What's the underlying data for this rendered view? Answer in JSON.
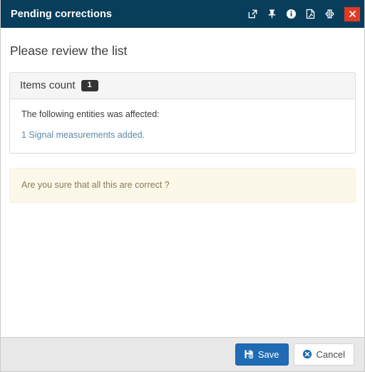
{
  "window": {
    "title": "Pending corrections",
    "titlebar_color": "#083e5c",
    "close_button_color": "#e23a22",
    "actions": [
      {
        "name": "popout-icon",
        "label": "Open in new window"
      },
      {
        "name": "pin-icon",
        "label": "Pin"
      },
      {
        "name": "info-icon",
        "label": "Information"
      },
      {
        "name": "pdf-icon",
        "label": "Export to PDF"
      },
      {
        "name": "collapse-horizontal-icon",
        "label": "Collapse"
      },
      {
        "name": "close-icon",
        "label": "Close"
      }
    ]
  },
  "main": {
    "page_title": "Please review the list",
    "panel": {
      "title": "Items count",
      "badge": "1",
      "badge_color": "#333333",
      "affected_text": "The following entities was affected:",
      "entity_link": "1 Signal measurements added.",
      "entity_link_color": "#5c8aa8"
    },
    "alert": {
      "text": "Are you sure that all this are correct ?",
      "background": "#fcf8e9",
      "border": "#f7f0d8",
      "text_color": "#8a7a52"
    }
  },
  "footer": {
    "save_label": "Save",
    "cancel_label": "Cancel",
    "save_color": "#1f6cb5"
  }
}
